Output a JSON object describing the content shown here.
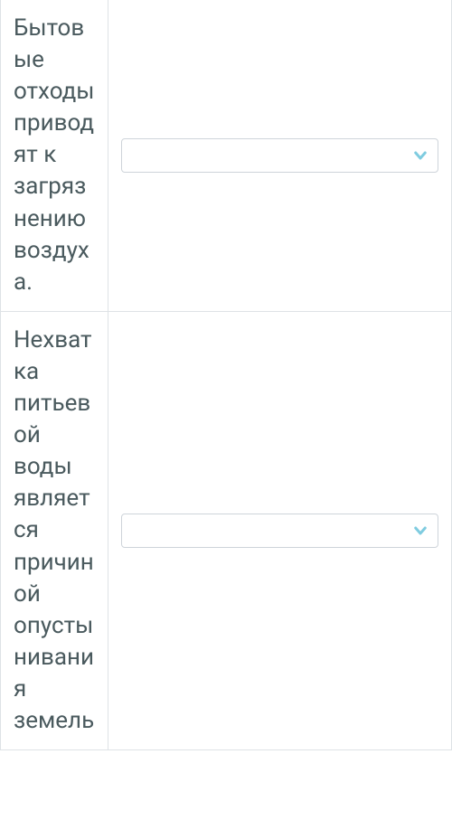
{
  "colors": {
    "text": "#4a5a5e",
    "border": "#dee2e6",
    "chevron": "#7fcce0"
  },
  "rows": [
    {
      "label": "Бытовые отходы приводят к загрязнению воздуха.",
      "selected": ""
    },
    {
      "label": "Нехватка питьевой воды является причиной опустынивания земель",
      "selected": ""
    }
  ]
}
